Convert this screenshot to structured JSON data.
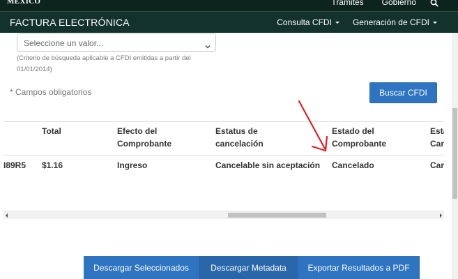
{
  "gov": {
    "logo_text": "MÉXICO",
    "links": [
      "Trámites",
      "Gobierno"
    ]
  },
  "app": {
    "title": "FACTURA ELECTRÓNICA",
    "menu": [
      "Consulta CFDI",
      "Generación de CFDI"
    ]
  },
  "form": {
    "select_placeholder": "Seleccione un valor...",
    "hint_line1": "(Criterio de búsqueda aplicable a CFDI emitidas a partir del",
    "hint_line2": "01/01/2014)",
    "required_note": "* Campos obligatorios",
    "search_button": "Buscar CFDI"
  },
  "table": {
    "headers": [
      {
        "line1": "Total",
        "line2": ""
      },
      {
        "line1": "Efecto del",
        "line2": "Comprobante"
      },
      {
        "line1": "Estatus de",
        "line2": "cancelación"
      },
      {
        "line1": "Estado del",
        "line2": "Comprobante"
      },
      {
        "line1": "Esta",
        "line2": "Can"
      }
    ],
    "row": {
      "partial_id": "I89R5",
      "total": "$1.16",
      "efecto": "Ingreso",
      "estatus_cancelacion": "Cancelable sin aceptación",
      "estado": "Cancelado",
      "partial_next": "Can"
    }
  },
  "bottom_buttons": [
    "Descargar Seleccionados",
    "Descargar Metadata",
    "Exportar Resultados a PDF"
  ],
  "colors": {
    "gov_bar": "#0c231e",
    "app_bar": "#13322b",
    "primary_button": "#2f74c0",
    "annotation_arrow": "#e02020"
  }
}
